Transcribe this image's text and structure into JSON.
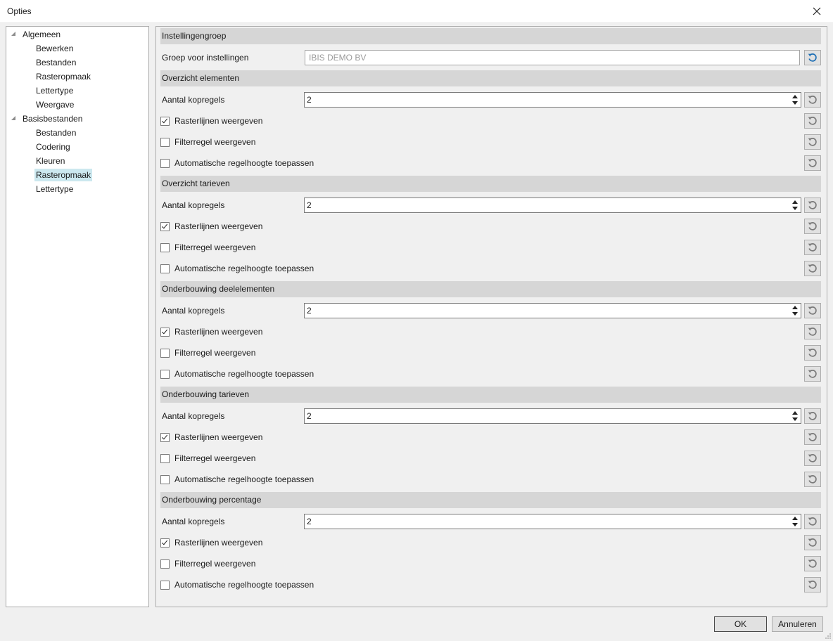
{
  "window": {
    "title": "Opties"
  },
  "tree": [
    {
      "label": "Algemeen",
      "level": 0,
      "expanded": true
    },
    {
      "label": "Bewerken",
      "level": 1
    },
    {
      "label": "Bestanden",
      "level": 1
    },
    {
      "label": "Rasteropmaak",
      "level": 1
    },
    {
      "label": "Lettertype",
      "level": 1
    },
    {
      "label": "Weergave",
      "level": 1
    },
    {
      "label": "Basisbestanden",
      "level": 0,
      "expanded": true
    },
    {
      "label": "Bestanden",
      "level": 1
    },
    {
      "label": "Codering",
      "level": 1
    },
    {
      "label": "Kleuren",
      "level": 1
    },
    {
      "label": "Rasteropmaak",
      "level": 1,
      "selected": true
    },
    {
      "label": "Lettertype",
      "level": 1
    }
  ],
  "settings_group": {
    "header": "Instellingengroep",
    "label": "Groep voor instellingen",
    "value": "IBIS DEMO BV"
  },
  "sections": [
    {
      "header": "Overzicht elementen",
      "spin_label": "Aantal kopregels",
      "spin_value": "2",
      "checks": [
        {
          "label": "Rasterlijnen weergeven",
          "checked": true
        },
        {
          "label": "Filterregel weergeven",
          "checked": false
        },
        {
          "label": "Automatische regelhoogte toepassen",
          "checked": false
        }
      ]
    },
    {
      "header": "Overzicht tarieven",
      "spin_label": "Aantal kopregels",
      "spin_value": "2",
      "checks": [
        {
          "label": "Rasterlijnen weergeven",
          "checked": true
        },
        {
          "label": "Filterregel weergeven",
          "checked": false
        },
        {
          "label": "Automatische regelhoogte toepassen",
          "checked": false
        }
      ]
    },
    {
      "header": "Onderbouwing deelelementen",
      "spin_label": "Aantal kopregels",
      "spin_value": "2",
      "checks": [
        {
          "label": "Rasterlijnen weergeven",
          "checked": true
        },
        {
          "label": "Filterregel weergeven",
          "checked": false
        },
        {
          "label": "Automatische regelhoogte toepassen",
          "checked": false
        }
      ]
    },
    {
      "header": "Onderbouwing tarieven",
      "spin_label": "Aantal kopregels",
      "spin_value": "2",
      "checks": [
        {
          "label": "Rasterlijnen weergeven",
          "checked": true
        },
        {
          "label": "Filterregel weergeven",
          "checked": false
        },
        {
          "label": "Automatische regelhoogte toepassen",
          "checked": false
        }
      ]
    },
    {
      "header": "Onderbouwing percentage",
      "spin_label": "Aantal kopregels",
      "spin_value": "2",
      "checks": [
        {
          "label": "Rasterlijnen weergeven",
          "checked": true
        },
        {
          "label": "Filterregel weergeven",
          "checked": false
        },
        {
          "label": "Automatische regelhoogte toepassen",
          "checked": false
        }
      ]
    }
  ],
  "buttons": {
    "ok": "OK",
    "cancel": "Annuleren"
  },
  "icons": {
    "close": "close-icon",
    "reset_active": "reset-icon-blue",
    "reset": "reset-icon-gray"
  },
  "colors": {
    "reset_active": "#1e6fb5",
    "reset_inactive": "#7a7a7a",
    "selected_bg": "#cce8ef"
  }
}
